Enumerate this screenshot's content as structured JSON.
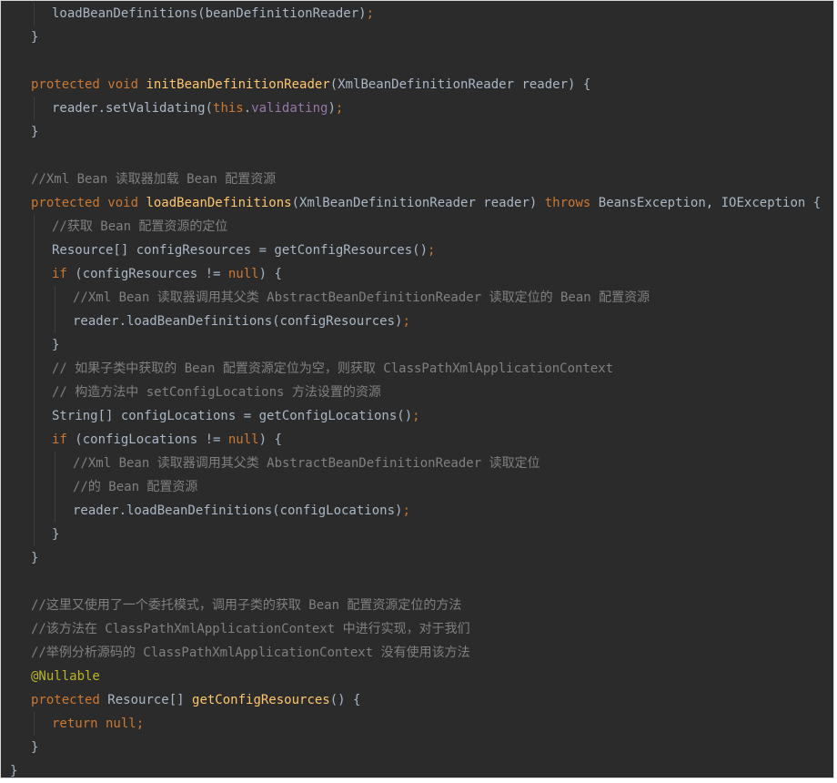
{
  "lines": [
    {
      "indent": 2,
      "tokens": [
        {
          "t": "loadBeanDefinitions(beanDefinitionReader)",
          "c": ""
        },
        {
          "t": ";",
          "c": "kw"
        }
      ]
    },
    {
      "indent": 1,
      "tokens": [
        {
          "t": "}",
          "c": ""
        }
      ]
    },
    {
      "indent": 0,
      "tokens": []
    },
    {
      "indent": 1,
      "tokens": [
        {
          "t": "protected void ",
          "c": "kw"
        },
        {
          "t": "initBeanDefinitionReader",
          "c": "fn"
        },
        {
          "t": "(XmlBeanDefinitionReader reader) {",
          "c": ""
        }
      ]
    },
    {
      "indent": 2,
      "tokens": [
        {
          "t": "reader.setValidating(",
          "c": ""
        },
        {
          "t": "this",
          "c": "kw"
        },
        {
          "t": ".",
          "c": ""
        },
        {
          "t": "validating",
          "c": "fld"
        },
        {
          "t": ")",
          "c": ""
        },
        {
          "t": ";",
          "c": "kw"
        }
      ]
    },
    {
      "indent": 1,
      "tokens": [
        {
          "t": "}",
          "c": ""
        }
      ]
    },
    {
      "indent": 0,
      "tokens": []
    },
    {
      "indent": 1,
      "tokens": [
        {
          "t": "//Xml Bean 读取器加载 Bean 配置资源",
          "c": "cm"
        }
      ]
    },
    {
      "indent": 1,
      "tokens": [
        {
          "t": "protected void ",
          "c": "kw"
        },
        {
          "t": "loadBeanDefinitions",
          "c": "fn"
        },
        {
          "t": "(XmlBeanDefinitionReader reader) ",
          "c": ""
        },
        {
          "t": "throws ",
          "c": "kw"
        },
        {
          "t": "BeansException, IOException {",
          "c": ""
        }
      ]
    },
    {
      "indent": 2,
      "tokens": [
        {
          "t": "//获取 Bean 配置资源的定位",
          "c": "cm"
        }
      ]
    },
    {
      "indent": 2,
      "tokens": [
        {
          "t": "Resource[] configResources = getConfigResources()",
          "c": ""
        },
        {
          "t": ";",
          "c": "kw"
        }
      ]
    },
    {
      "indent": 2,
      "tokens": [
        {
          "t": "if ",
          "c": "kw"
        },
        {
          "t": "(configResources != ",
          "c": ""
        },
        {
          "t": "null",
          "c": "kw"
        },
        {
          "t": ") {",
          "c": ""
        }
      ]
    },
    {
      "indent": 3,
      "tokens": [
        {
          "t": "//Xml Bean 读取器调用其父类 AbstractBeanDefinitionReader 读取定位的 Bean 配置资源",
          "c": "cm"
        }
      ]
    },
    {
      "indent": 3,
      "tokens": [
        {
          "t": "reader.loadBeanDefinitions(configResources)",
          "c": ""
        },
        {
          "t": ";",
          "c": "kw"
        }
      ]
    },
    {
      "indent": 2,
      "tokens": [
        {
          "t": "}",
          "c": ""
        }
      ]
    },
    {
      "indent": 2,
      "tokens": [
        {
          "t": "// 如果子类中获取的 Bean 配置资源定位为空，则获取 ClassPathXmlApplicationContext",
          "c": "cm"
        }
      ]
    },
    {
      "indent": 2,
      "tokens": [
        {
          "t": "// 构造方法中 setConfigLocations 方法设置的资源",
          "c": "cm"
        }
      ]
    },
    {
      "indent": 2,
      "tokens": [
        {
          "t": "String[] configLocations = getConfigLocations()",
          "c": ""
        },
        {
          "t": ";",
          "c": "kw"
        }
      ]
    },
    {
      "indent": 2,
      "tokens": [
        {
          "t": "if ",
          "c": "kw"
        },
        {
          "t": "(configLocations != ",
          "c": ""
        },
        {
          "t": "null",
          "c": "kw"
        },
        {
          "t": ") {",
          "c": ""
        }
      ]
    },
    {
      "indent": 3,
      "tokens": [
        {
          "t": "//Xml Bean 读取器调用其父类 AbstractBeanDefinitionReader 读取定位",
          "c": "cm"
        }
      ]
    },
    {
      "indent": 3,
      "tokens": [
        {
          "t": "//的 Bean 配置资源",
          "c": "cm"
        }
      ]
    },
    {
      "indent": 3,
      "tokens": [
        {
          "t": "reader.loadBeanDefinitions(configLocations)",
          "c": ""
        },
        {
          "t": ";",
          "c": "kw"
        }
      ]
    },
    {
      "indent": 2,
      "tokens": [
        {
          "t": "}",
          "c": ""
        }
      ]
    },
    {
      "indent": 1,
      "tokens": [
        {
          "t": "}",
          "c": ""
        }
      ]
    },
    {
      "indent": 0,
      "tokens": []
    },
    {
      "indent": 1,
      "tokens": [
        {
          "t": "//这里又使用了一个委托模式，调用子类的获取 Bean 配置资源定位的方法",
          "c": "cm"
        }
      ]
    },
    {
      "indent": 1,
      "tokens": [
        {
          "t": "//该方法在 ClassPathXmlApplicationContext 中进行实现，对于我们",
          "c": "cm"
        }
      ]
    },
    {
      "indent": 1,
      "tokens": [
        {
          "t": "//举例分析源码的 ClassPathXmlApplicationContext 没有使用该方法",
          "c": "cm"
        }
      ]
    },
    {
      "indent": 1,
      "tokens": [
        {
          "t": "@Nullable",
          "c": "ann"
        }
      ]
    },
    {
      "indent": 1,
      "tokens": [
        {
          "t": "protected ",
          "c": "kw"
        },
        {
          "t": "Resource[] ",
          "c": ""
        },
        {
          "t": "getConfigResources",
          "c": "fn"
        },
        {
          "t": "() {",
          "c": ""
        }
      ]
    },
    {
      "indent": 2,
      "tokens": [
        {
          "t": "return null",
          "c": "kw"
        },
        {
          "t": ";",
          "c": "kw"
        }
      ]
    },
    {
      "indent": 1,
      "tokens": [
        {
          "t": "}",
          "c": ""
        }
      ]
    },
    {
      "indent": 0,
      "tokens": [
        {
          "t": "}",
          "c": ""
        }
      ]
    }
  ]
}
